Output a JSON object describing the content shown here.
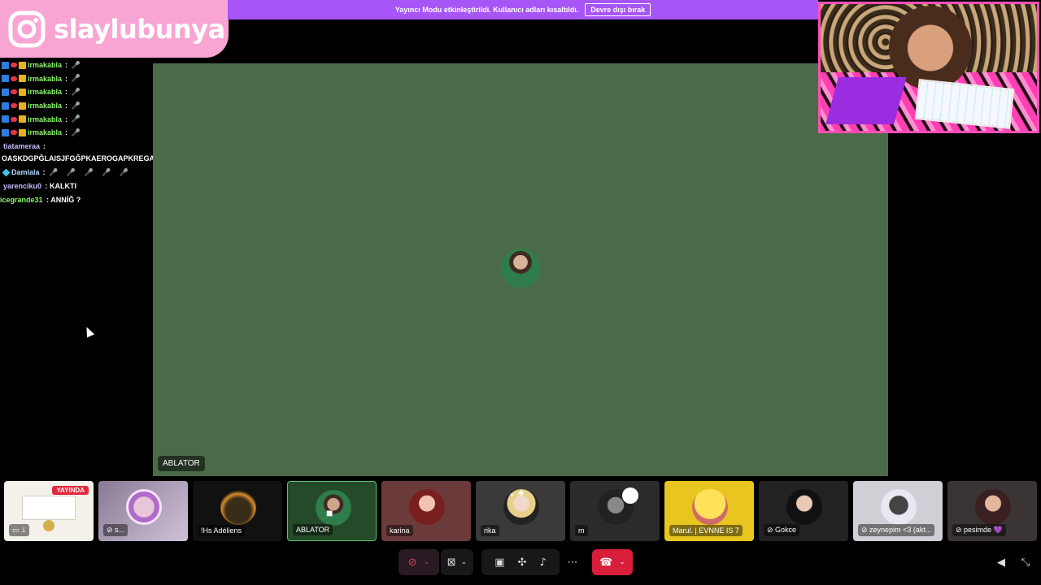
{
  "banner": {
    "text": "Yayıncı Modu etkinleştirildi. Kullanıcı adları kısaltıldı.",
    "button": "Devre dışı bırak"
  },
  "logo": {
    "name": "slaylubunya",
    "icon": "instagram-icon"
  },
  "chat": {
    "irmakabla_lines": [
      {
        "user": "irmakabla",
        "sep": ":",
        "emote": "🎤"
      },
      {
        "user": "irmakabla",
        "sep": ":",
        "emote": "🎤"
      },
      {
        "user": "irmakabla",
        "sep": ":",
        "emote": "🎤"
      },
      {
        "user": "irmakabla",
        "sep": ":",
        "emote": "🎤"
      },
      {
        "user": "irmakabla",
        "sep": ":",
        "emote": "🎤"
      },
      {
        "user": "irmakabla",
        "sep": ":",
        "emote": "🎤"
      }
    ],
    "tiatameraa": {
      "user": "tiatameraa",
      "sep": ":",
      "message": "OASKDGPĞLAISJFGĞPKAEROGAPKREGAHOIERPKHOOAEJRH"
    },
    "damlala": {
      "user": "Damlala",
      "sep": ":",
      "emotes": "🎤 🎤 🎤 🎤 🎤"
    },
    "yarenciku": {
      "user": "yarenciku0",
      "message": ": KALKTI"
    },
    "icegrande": {
      "user": "icegrande31",
      "message": ": ANNİĞ ?"
    },
    "colors": {
      "irmakabla": "#8cf56a",
      "tiatameraa": "#c9b8ff",
      "damlala": "#b3d8ff",
      "yarenciku": "#c9b8ff",
      "icegrande": "#8cf56a"
    }
  },
  "stage": {
    "name": "ABLATOR",
    "background": "#4b6b48"
  },
  "tiles": [
    {
      "label": "",
      "badge": "YAYINDA"
    },
    {
      "label": "s..."
    },
    {
      "label": "!Hs Adéliens"
    },
    {
      "label": "ABLATOR"
    },
    {
      "label": "karina"
    },
    {
      "label": "rika"
    },
    {
      "label": "m"
    },
    {
      "label": "Marul. | EVNNE IS 7"
    },
    {
      "label": "Gokce"
    },
    {
      "label": "zeynepim <3 (akt..."
    },
    {
      "label": "pesimde 💜"
    }
  ],
  "controls": {
    "mic": "mic-off-icon",
    "camera": "camera-off-icon",
    "screen_share": "screen-share-icon",
    "activities": "activities-icon",
    "soundboard": "soundboard-icon",
    "more": "⋯",
    "leave": "phone-hangup-icon",
    "volume": "volume-icon",
    "exit_fullscreen": "exit-fullscreen-icon"
  }
}
